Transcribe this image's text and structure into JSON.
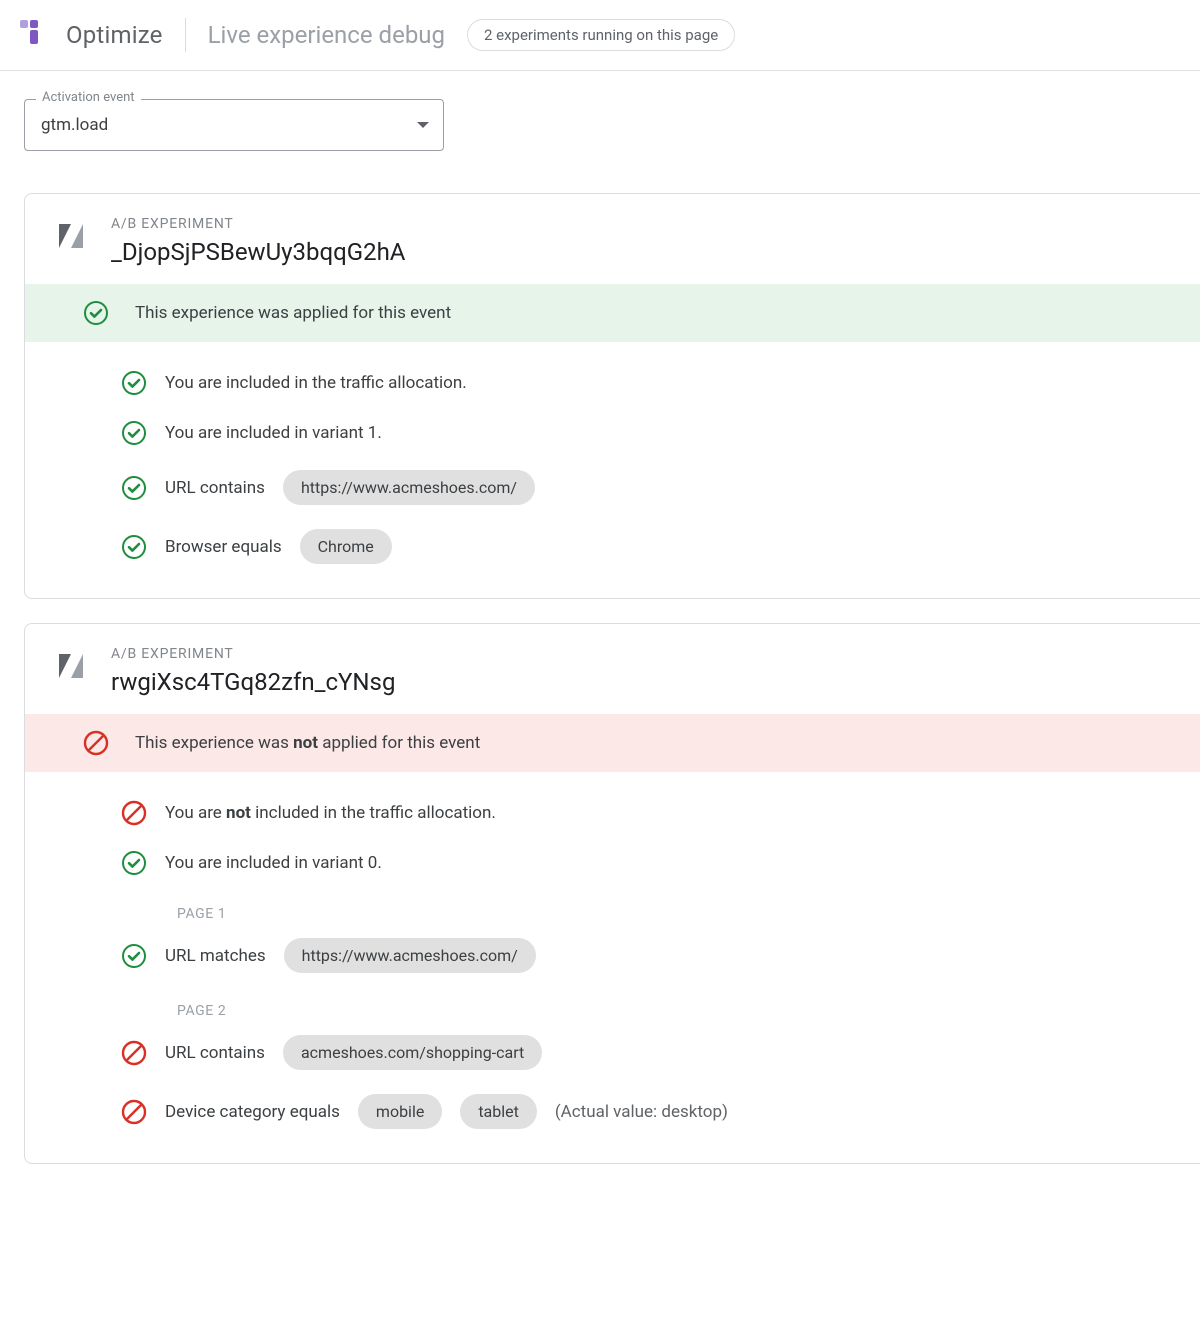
{
  "header": {
    "product": "Optimize",
    "page_title": "Live experience debug",
    "summary_chip": "2 experiments running on this page"
  },
  "filter": {
    "label": "Activation event",
    "value": "gtm.load"
  },
  "experiments": [
    {
      "type_label": "A/B EXPERIMENT",
      "id": "_DjopSjPSBewUy3bqqG2hA",
      "status": {
        "applied": true,
        "text": "This experience was applied for this event"
      },
      "rows": [
        {
          "icon": "check",
          "text": "You are included in the traffic allocation."
        },
        {
          "icon": "check",
          "text": "You are included in variant 1."
        },
        {
          "icon": "check",
          "text": "URL contains",
          "pills": [
            "https://www.acmeshoes.com/"
          ]
        },
        {
          "icon": "check",
          "text": "Browser equals",
          "pills": [
            "Chrome"
          ]
        }
      ]
    },
    {
      "type_label": "A/B EXPERIMENT",
      "id": "rwgiXsc4TGq82zfn_cYNsg",
      "status": {
        "applied": false,
        "text_pre": "This experience was ",
        "bold": "not",
        "text_post": " applied for this event"
      },
      "rows": [
        {
          "icon": "block",
          "text_pre": "You are ",
          "bold": "not",
          "text_post": " included in the traffic allocation."
        },
        {
          "icon": "check",
          "text": "You are included in variant 0."
        },
        {
          "section": "PAGE 1"
        },
        {
          "icon": "check",
          "text": "URL matches",
          "pills": [
            "https://www.acmeshoes.com/"
          ]
        },
        {
          "section": "PAGE 2"
        },
        {
          "icon": "block",
          "text": "URL contains",
          "pills": [
            "acmeshoes.com/shopping-cart"
          ]
        },
        {
          "icon": "block",
          "text": "Device category equals",
          "pills": [
            "mobile",
            "tablet"
          ],
          "trailing": "(Actual value: desktop)"
        }
      ]
    }
  ]
}
